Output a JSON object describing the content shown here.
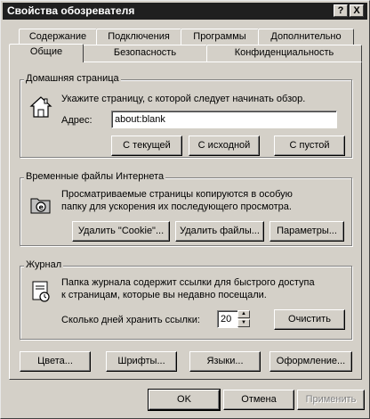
{
  "window": {
    "title": "Свойства обозревателя",
    "help_label": "?",
    "close_label": "X"
  },
  "tabs": {
    "row1": [
      "Содержание",
      "Подключения",
      "Программы",
      "Дополнительно"
    ],
    "row2": [
      "Общие",
      "Безопасность",
      "Конфиденциальность"
    ],
    "active": "Общие"
  },
  "home": {
    "group_label": "Домашняя страница",
    "description": "Укажите страницу, с которой следует начинать обзор.",
    "address_label": "Адрес:",
    "address_value": "about:blank",
    "btn_current": "С текущей",
    "btn_default": "С исходной",
    "btn_blank": "С пустой"
  },
  "temp": {
    "group_label": "Временные файлы Интернета",
    "description_line1": "Просматриваемые страницы копируются в особую",
    "description_line2": "папку для ускорения их последующего просмотра.",
    "btn_delete_cookies": "Удалить \"Cookie\"...",
    "btn_delete_files": "Удалить файлы...",
    "btn_settings": "Параметры..."
  },
  "history": {
    "group_label": "Журнал",
    "description_line1": "Папка журнала содержит ссылки для быстрого доступа",
    "description_line2": "к страницам, которые вы недавно посещали.",
    "days_label": "Сколько дней хранить ссылки:",
    "days_value": "20",
    "btn_clear": "Очистить"
  },
  "bottom_panel": {
    "btn_colors": "Цвета...",
    "btn_fonts": "Шрифты...",
    "btn_languages": "Языки...",
    "btn_accessibility": "Оформление..."
  },
  "dialog": {
    "btn_ok": "OK",
    "btn_cancel": "Отмена",
    "btn_apply": "Применить"
  }
}
